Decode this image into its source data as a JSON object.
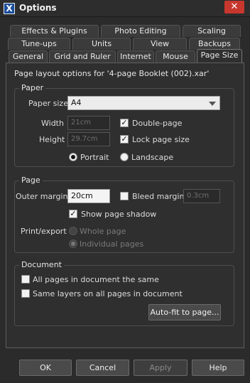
{
  "window": {
    "title": "Options",
    "close_glyph": "✕",
    "app_icon_glyph": "X"
  },
  "tabs": {
    "row1": [
      "Effects & Plugins",
      "Photo Editing",
      "Scaling"
    ],
    "row2": [
      "Tune-ups",
      "Units",
      "View",
      "Backups"
    ],
    "row3": [
      "General",
      "Grid and Ruler",
      "Internet",
      "Mouse",
      "Page Size"
    ],
    "active": "Page Size"
  },
  "header": "Page layout options for '4-page Booklet (002).xar'",
  "paper": {
    "title": "Paper",
    "size_label": "Paper size",
    "size_value": "A4",
    "width_label": "Width",
    "width_value": "21cm",
    "height_label": "Height",
    "height_value": "29.7cm",
    "double_page_label": "Double-page",
    "double_page_checked": true,
    "lock_label": "Lock page size",
    "lock_checked": true,
    "portrait_label": "Portrait",
    "landscape_label": "Landscape",
    "orientation": "Portrait"
  },
  "page": {
    "title": "Page",
    "outer_margin_label": "Outer margin",
    "outer_margin_value": "20cm",
    "bleed_label": "Bleed margin",
    "bleed_checked": false,
    "bleed_value": "0.3cm",
    "shadow_label": "Show page shadow",
    "shadow_checked": true,
    "print_export_label": "Print/export",
    "whole_page_label": "Whole page",
    "individual_pages_label": "Individual pages",
    "print_selected": "Individual pages"
  },
  "document": {
    "title": "Document",
    "all_same_label": "All pages in document the same",
    "all_same_checked": false,
    "same_layers_label": "Same layers on all pages in document",
    "same_layers_checked": false,
    "autofit_label": "Auto-fit to page..."
  },
  "buttons": {
    "ok": "OK",
    "cancel": "Cancel",
    "apply": "Apply",
    "help": "Help"
  },
  "check_glyph": "✓",
  "colors": {
    "background": "#2b2b2b",
    "panel": "#2f2f2f",
    "close_button": "#c8372d",
    "app_icon": "#1b4e9c"
  }
}
